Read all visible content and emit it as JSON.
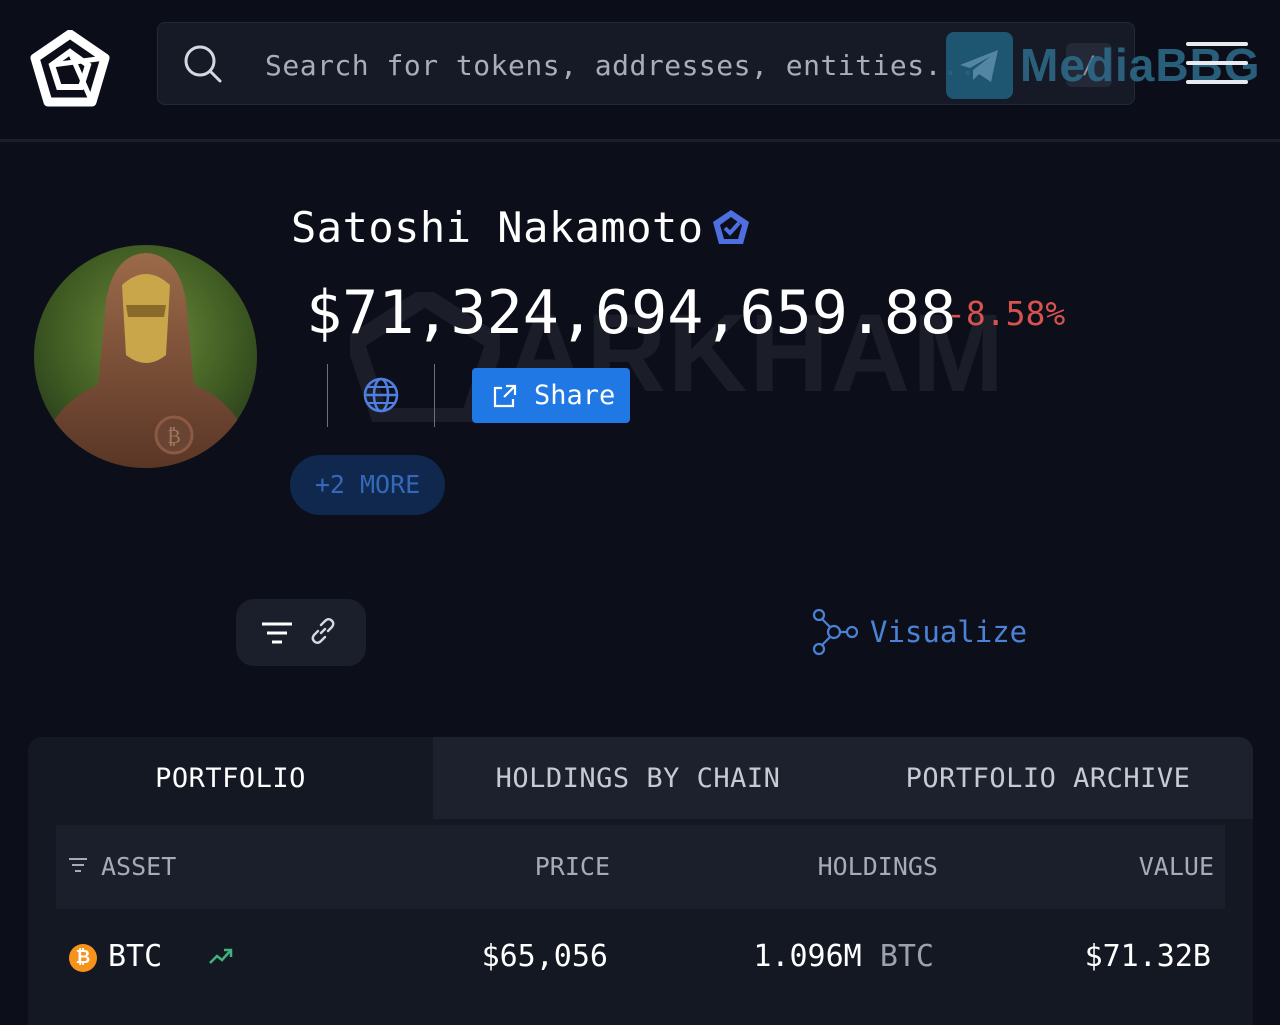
{
  "header": {
    "search_placeholder": "Search for tokens, addresses, entities...",
    "search_shortcut": "/",
    "watermark_text": "MediaBBG"
  },
  "entity": {
    "name": "Satoshi Nakamoto",
    "balance": "$71,324,694,659.88",
    "change": "-8.58%",
    "share_label": "Share",
    "more_label": "+2 MORE",
    "watermark": "ARKHAM"
  },
  "tools": {
    "visualize_label": "Visualize"
  },
  "tabs": [
    {
      "label": "PORTFOLIO",
      "active": true
    },
    {
      "label": "HOLDINGS BY CHAIN",
      "active": false
    },
    {
      "label": "PORTFOLIO ARCHIVE",
      "active": false
    }
  ],
  "table": {
    "columns": [
      "ASSET",
      "PRICE",
      "HOLDINGS",
      "VALUE"
    ],
    "rows": [
      {
        "symbol": "BTC",
        "price": "$65,056",
        "holdings": "1.096M",
        "holdings_unit": "BTC",
        "value": "$71.32B"
      }
    ]
  },
  "colors": {
    "background": "#0c0f1a",
    "accent_blue": "#1f78e3",
    "negative": "#d8534f",
    "btc_orange": "#f7931a",
    "trend_green": "#3fb27f"
  },
  "icons": [
    "arkham-logo-icon",
    "search-icon",
    "menu-icon",
    "verified-icon",
    "globe-icon",
    "share-icon",
    "filter-icon",
    "link-icon",
    "visualize-icon",
    "sort-icon",
    "btc-icon",
    "trend-up-icon"
  ]
}
